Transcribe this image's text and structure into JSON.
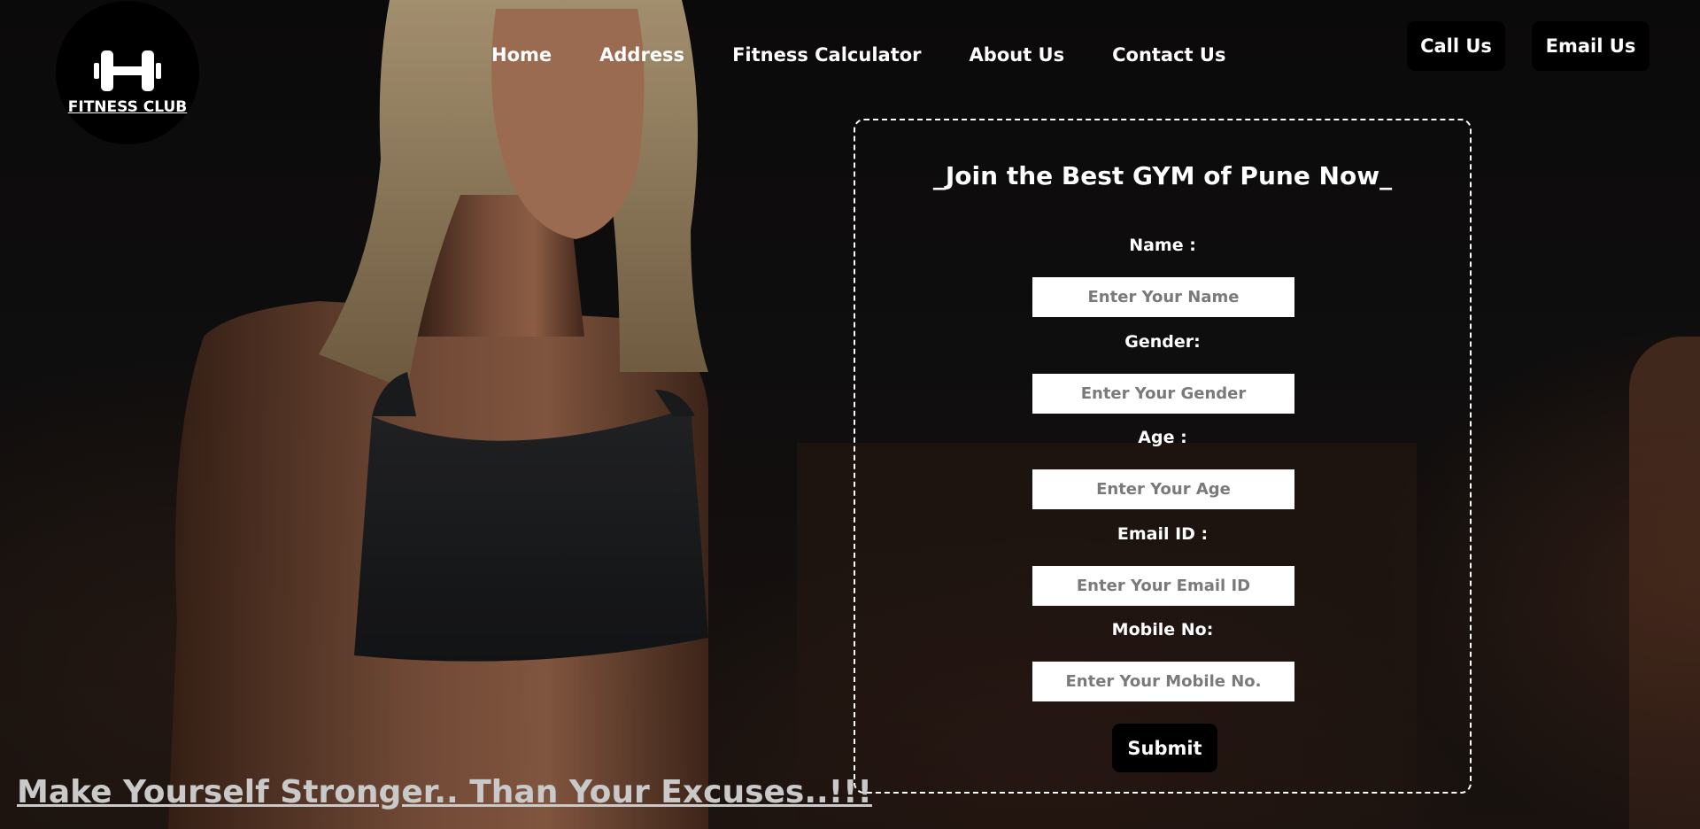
{
  "logo": {
    "text": "FITNESS CLUB",
    "icon": "dumbbell-icon"
  },
  "nav": {
    "items": [
      "Home",
      "Address",
      "Fitness Calculator",
      "About Us",
      "Contact Us"
    ]
  },
  "actions": {
    "call_label": "Call Us",
    "email_label": "Email Us"
  },
  "form": {
    "title": "_Join the Best GYM of Pune Now_",
    "fields": [
      {
        "label": "Name :",
        "placeholder": "Enter Your Name",
        "value": ""
      },
      {
        "label": "Gender:",
        "placeholder": "Enter Your Gender",
        "value": ""
      },
      {
        "label": "Age :",
        "placeholder": "Enter Your Age",
        "value": ""
      },
      {
        "label": "Email ID :",
        "placeholder": "Enter Your Email ID",
        "value": ""
      },
      {
        "label": "Mobile No:",
        "placeholder": "Enter Your Mobile No.",
        "value": ""
      }
    ],
    "submit_label": "Submit"
  },
  "tagline": "Make Yourself Stronger.. Than Your Excuses..!!!",
  "colors": {
    "background": "#0c0b0b",
    "button_bg": "#000000",
    "text": "#ffffff",
    "tagline": "#c9c9c9"
  }
}
